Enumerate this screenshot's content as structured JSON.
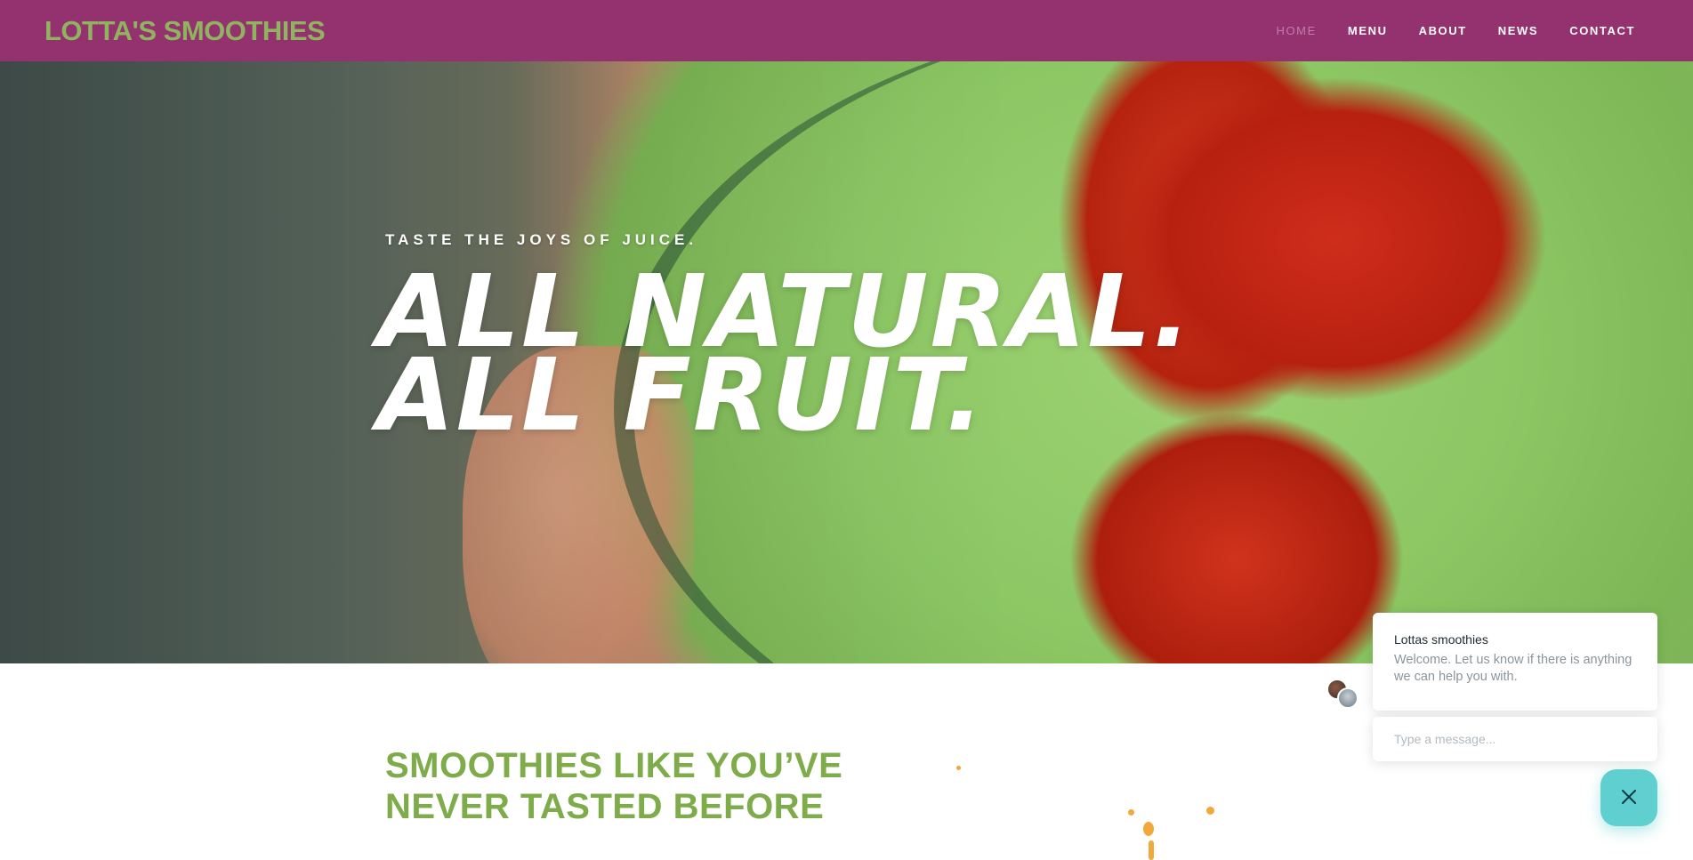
{
  "header": {
    "logo": "LOTTA'S SMOOTHIES",
    "nav": [
      {
        "label": "HOME",
        "active": true
      },
      {
        "label": "MENU",
        "active": false
      },
      {
        "label": "ABOUT",
        "active": false
      },
      {
        "label": "NEWS",
        "active": false
      },
      {
        "label": "CONTACT",
        "active": false
      }
    ]
  },
  "hero": {
    "tagline": "TASTE THE JOYS OF JUICE.",
    "heading_line1": "ALL NATURAL.",
    "heading_line2": "ALL FRUIT."
  },
  "section": {
    "title_line1": "SMOOTHIES LIKE YOU’VE",
    "title_line2": "NEVER TASTED BEFORE"
  },
  "chat": {
    "name": "Lottas smoothies",
    "message": "Welcome. Let us know if there is anything we can help you with.",
    "input_placeholder": "Type a message...",
    "close_icon": "close-icon"
  },
  "colors": {
    "header_bg": "#94326f",
    "logo": "#8fb35e",
    "section_title": "#7fac4a",
    "chat_button": "#5fcfcf"
  }
}
